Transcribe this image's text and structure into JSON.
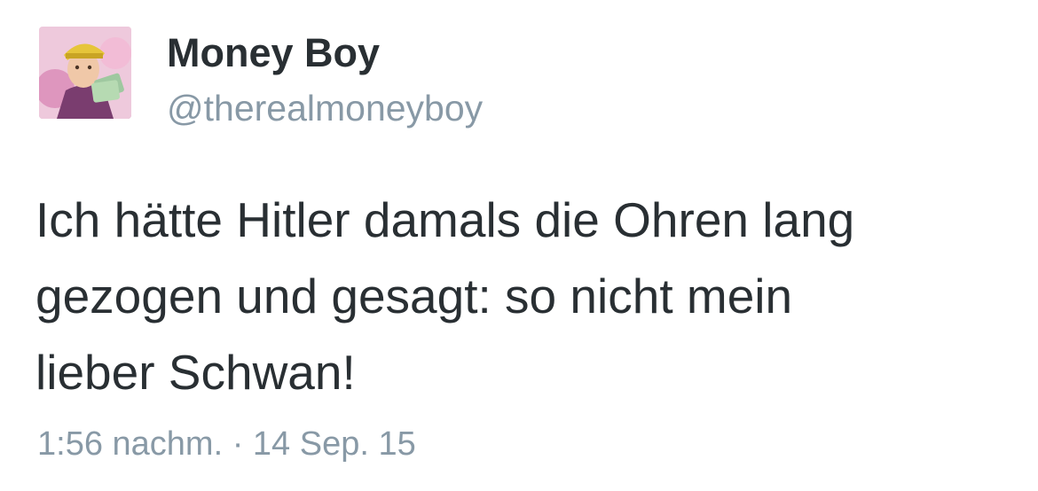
{
  "tweet": {
    "author": {
      "name": "Money Boy",
      "handle": "@therealmoneyboy",
      "avatar_icon": "profile-photo"
    },
    "text_lines": [
      "Ich hätte Hitler damals die Ohren lang",
      "gezogen und gesagt: so nicht mein",
      "lieber Schwan!"
    ],
    "time": "1:56 nachm.",
    "separator": "·",
    "date": "14 Sep. 15"
  },
  "colors": {
    "name_text": "#292f33",
    "secondary_text": "#8899a6",
    "background": "#ffffff"
  }
}
